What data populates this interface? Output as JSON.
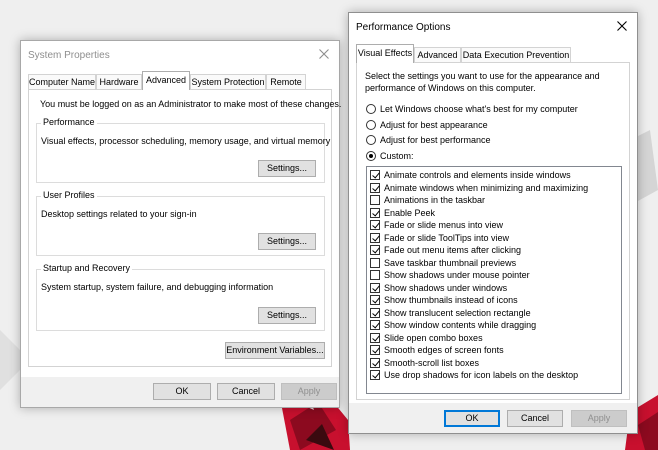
{
  "system_properties": {
    "title": "System Properties",
    "tabs": [
      {
        "label": "Computer Name",
        "active": false
      },
      {
        "label": "Hardware",
        "active": false
      },
      {
        "label": "Advanced",
        "active": true
      },
      {
        "label": "System Protection",
        "active": false
      },
      {
        "label": "Remote",
        "active": false
      }
    ],
    "admin_notice": "You must be logged on as an Administrator to make most of these changes.",
    "groups": [
      {
        "label": "Performance",
        "description": "Visual effects, processor scheduling, memory usage, and virtual memory",
        "button": "Settings..."
      },
      {
        "label": "User Profiles",
        "description": "Desktop settings related to your sign-in",
        "button": "Settings..."
      },
      {
        "label": "Startup and Recovery",
        "description": "System startup, system failure, and debugging information",
        "button": "Settings..."
      }
    ],
    "env_button": "Environment Variables...",
    "footer": {
      "ok": "OK",
      "cancel": "Cancel",
      "apply": "Apply"
    }
  },
  "performance_options": {
    "title": "Performance Options",
    "tabs": [
      {
        "label": "Visual Effects",
        "active": true
      },
      {
        "label": "Advanced",
        "active": false
      },
      {
        "label": "Data Execution Prevention",
        "active": false
      }
    ],
    "instruction_line1": "Select the settings you want to use for the appearance and",
    "instruction_line2": "performance of Windows on this computer.",
    "radios": [
      {
        "label": "Let Windows choose what's best for my computer",
        "selected": false
      },
      {
        "label": "Adjust for best appearance",
        "selected": false
      },
      {
        "label": "Adjust for best performance",
        "selected": false
      },
      {
        "label": "Custom:",
        "selected": true
      }
    ],
    "effects": [
      {
        "label": "Animate controls and elements inside windows",
        "checked": true
      },
      {
        "label": "Animate windows when minimizing and maximizing",
        "checked": true
      },
      {
        "label": "Animations in the taskbar",
        "checked": false
      },
      {
        "label": "Enable Peek",
        "checked": true
      },
      {
        "label": "Fade or slide menus into view",
        "checked": true
      },
      {
        "label": "Fade or slide ToolTips into view",
        "checked": true
      },
      {
        "label": "Fade out menu items after clicking",
        "checked": true
      },
      {
        "label": "Save taskbar thumbnail previews",
        "checked": false
      },
      {
        "label": "Show shadows under mouse pointer",
        "checked": false
      },
      {
        "label": "Show shadows under windows",
        "checked": true
      },
      {
        "label": "Show thumbnails instead of icons",
        "checked": true
      },
      {
        "label": "Show translucent selection rectangle",
        "checked": true
      },
      {
        "label": "Show window contents while dragging",
        "checked": true
      },
      {
        "label": "Slide open combo boxes",
        "checked": true
      },
      {
        "label": "Smooth edges of screen fonts",
        "checked": true
      },
      {
        "label": "Smooth-scroll list boxes",
        "checked": true
      },
      {
        "label": "Use drop shadows for icon labels on the desktop",
        "checked": true
      }
    ],
    "footer": {
      "ok": "OK",
      "cancel": "Cancel",
      "apply": "Apply"
    }
  },
  "colors": {
    "wallpaper_bg": "#efefef",
    "accent": "#0078d7",
    "red_shape": "#c8102e",
    "dark_shape": "#3a0a0f"
  }
}
